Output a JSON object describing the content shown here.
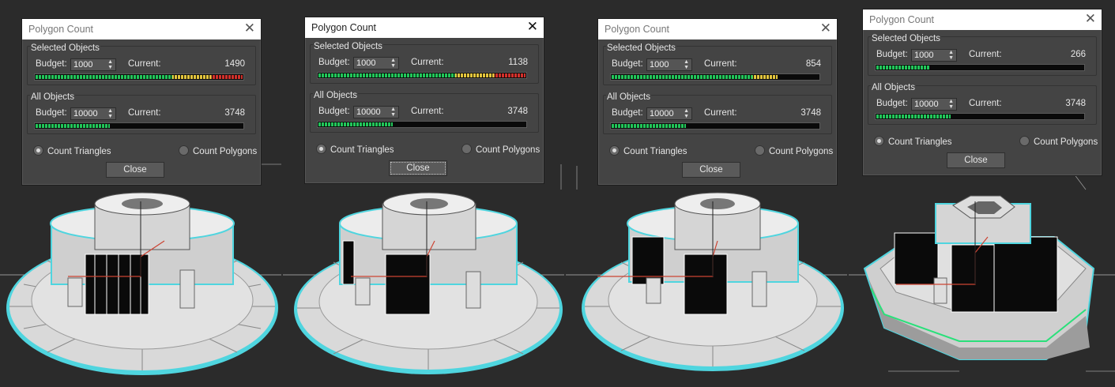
{
  "panels": [
    {
      "title": "Polygon Count",
      "active": false,
      "selected_label": "Selected Objects",
      "all_label": "All Objects",
      "budget_label": "Budget:",
      "current_label": "Current:",
      "selected_budget": "1000",
      "selected_current": "1490",
      "selected_fill": 1.0,
      "all_budget": "10000",
      "all_current": "3748",
      "all_fill": 0.36,
      "radio_triangles": "Count Triangles",
      "radio_polygons": "Count Polygons",
      "close_label": "Close",
      "close_focused": false
    },
    {
      "title": "Polygon Count",
      "active": true,
      "selected_label": "Selected Objects",
      "all_label": "All Objects",
      "budget_label": "Budget:",
      "current_label": "Current:",
      "selected_budget": "1000",
      "selected_current": "1138",
      "selected_fill": 1.0,
      "all_budget": "10000",
      "all_current": "3748",
      "all_fill": 0.36,
      "radio_triangles": "Count Triangles",
      "radio_polygons": "Count Polygons",
      "close_label": "Close",
      "close_focused": true
    },
    {
      "title": "Polygon Count",
      "active": false,
      "selected_label": "Selected Objects",
      "all_label": "All Objects",
      "budget_label": "Budget:",
      "current_label": "Current:",
      "selected_budget": "1000",
      "selected_current": "854",
      "selected_fill": 0.8,
      "all_budget": "10000",
      "all_current": "3748",
      "all_fill": 0.36,
      "radio_triangles": "Count Triangles",
      "radio_polygons": "Count Polygons",
      "close_label": "Close",
      "close_focused": false
    },
    {
      "title": "Polygon Count",
      "active": false,
      "selected_label": "Selected Objects",
      "all_label": "All Objects",
      "budget_label": "Budget:",
      "current_label": "Current:",
      "selected_budget": "1000",
      "selected_current": "266",
      "selected_fill": 0.26,
      "all_budget": "10000",
      "all_current": "3748",
      "all_fill": 0.36,
      "radio_triangles": "Count Triangles",
      "radio_polygons": "Count Polygons",
      "close_label": "Close",
      "close_focused": false
    }
  ],
  "colors": {
    "viewport_bg": "#2b2b2b",
    "meter_green": "#22c65a",
    "meter_yellow": "#e3c53d",
    "meter_red": "#d2302b",
    "selection_outline": "#3fd6e0",
    "selection_edge": "#29e07a"
  }
}
